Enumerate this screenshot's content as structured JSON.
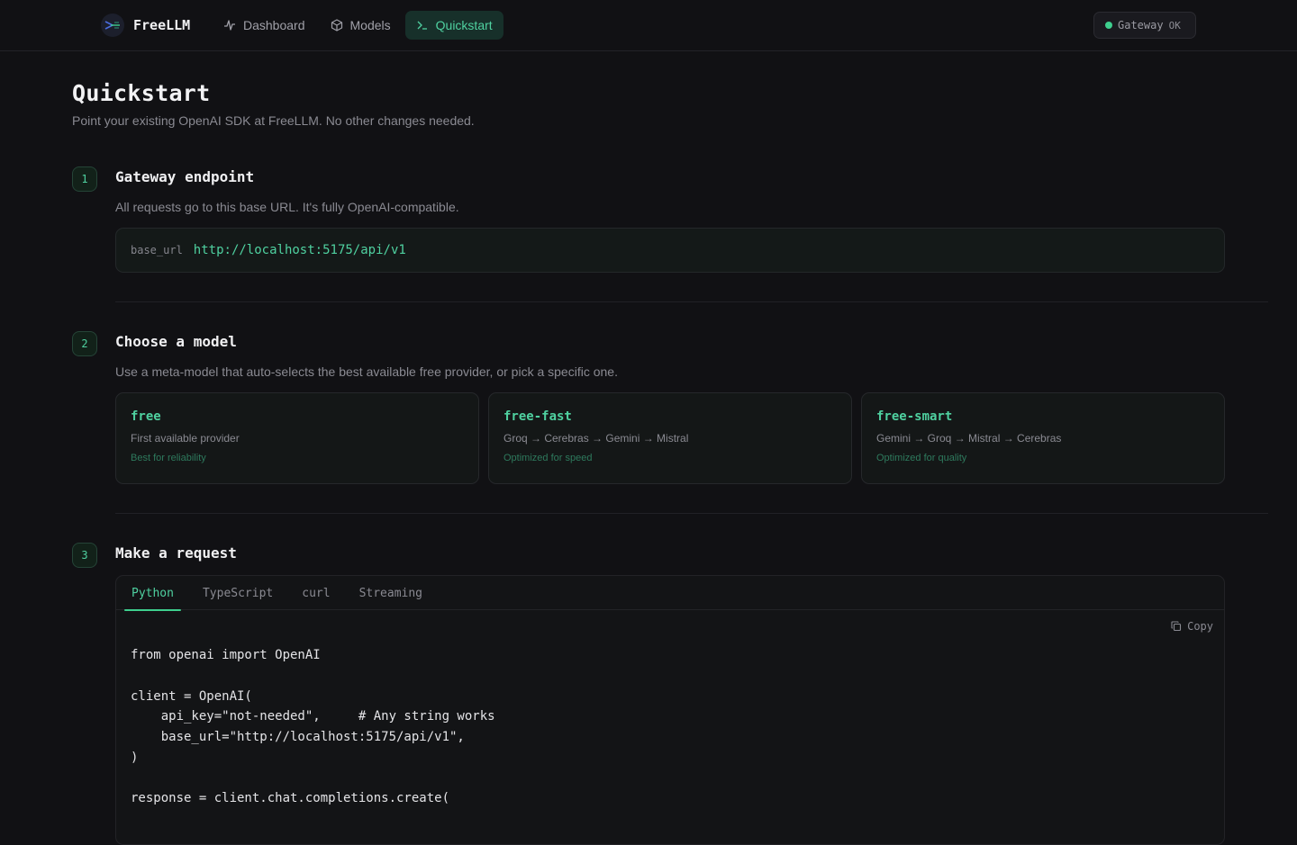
{
  "nav": {
    "brand": "FreeLLM",
    "items": [
      {
        "label": "Dashboard",
        "icon": "activity-icon"
      },
      {
        "label": "Models",
        "icon": "cube-icon"
      },
      {
        "label": "Quickstart",
        "icon": "terminal-icon",
        "active": true
      }
    ],
    "gateway": {
      "label": "Gateway",
      "status": "OK",
      "status_color": "#3ecf8e"
    }
  },
  "page": {
    "title": "Quickstart",
    "subtitle": "Point your existing OpenAI SDK at FreeLLM. No other changes needed."
  },
  "steps": [
    {
      "number": "1",
      "title": "Gateway endpoint",
      "description": "All requests go to this base URL. It's fully OpenAI-compatible.",
      "endpoint": {
        "label": "base_url",
        "value": "http://localhost:5175/api/v1"
      }
    },
    {
      "number": "2",
      "title": "Choose a model",
      "description": "Use a meta-model that auto-selects the best available free provider, or pick a specific one.",
      "models": [
        {
          "name": "free",
          "route": "First available provider",
          "note": "Best for reliability"
        },
        {
          "name": "free-fast",
          "route": "Groq → Cerebras → Gemini → Mistral",
          "note": "Optimized for speed"
        },
        {
          "name": "free-smart",
          "route": "Gemini → Groq → Mistral → Cerebras",
          "note": "Optimized for quality"
        }
      ]
    },
    {
      "number": "3",
      "title": "Make a request",
      "tabs": [
        "Python",
        "TypeScript",
        "curl",
        "Streaming"
      ],
      "active_tab": "Python",
      "copy_label": "Copy",
      "code": "from openai import OpenAI\n\nclient = OpenAI(\n    api_key=\"not-needed\",     # Any string works\n    base_url=\"http://localhost:5175/api/v1\",\n)\n\nresponse = client.chat.completions.create("
    }
  ],
  "colors": {
    "accent": "#4fd1a0",
    "background": "#111114"
  }
}
